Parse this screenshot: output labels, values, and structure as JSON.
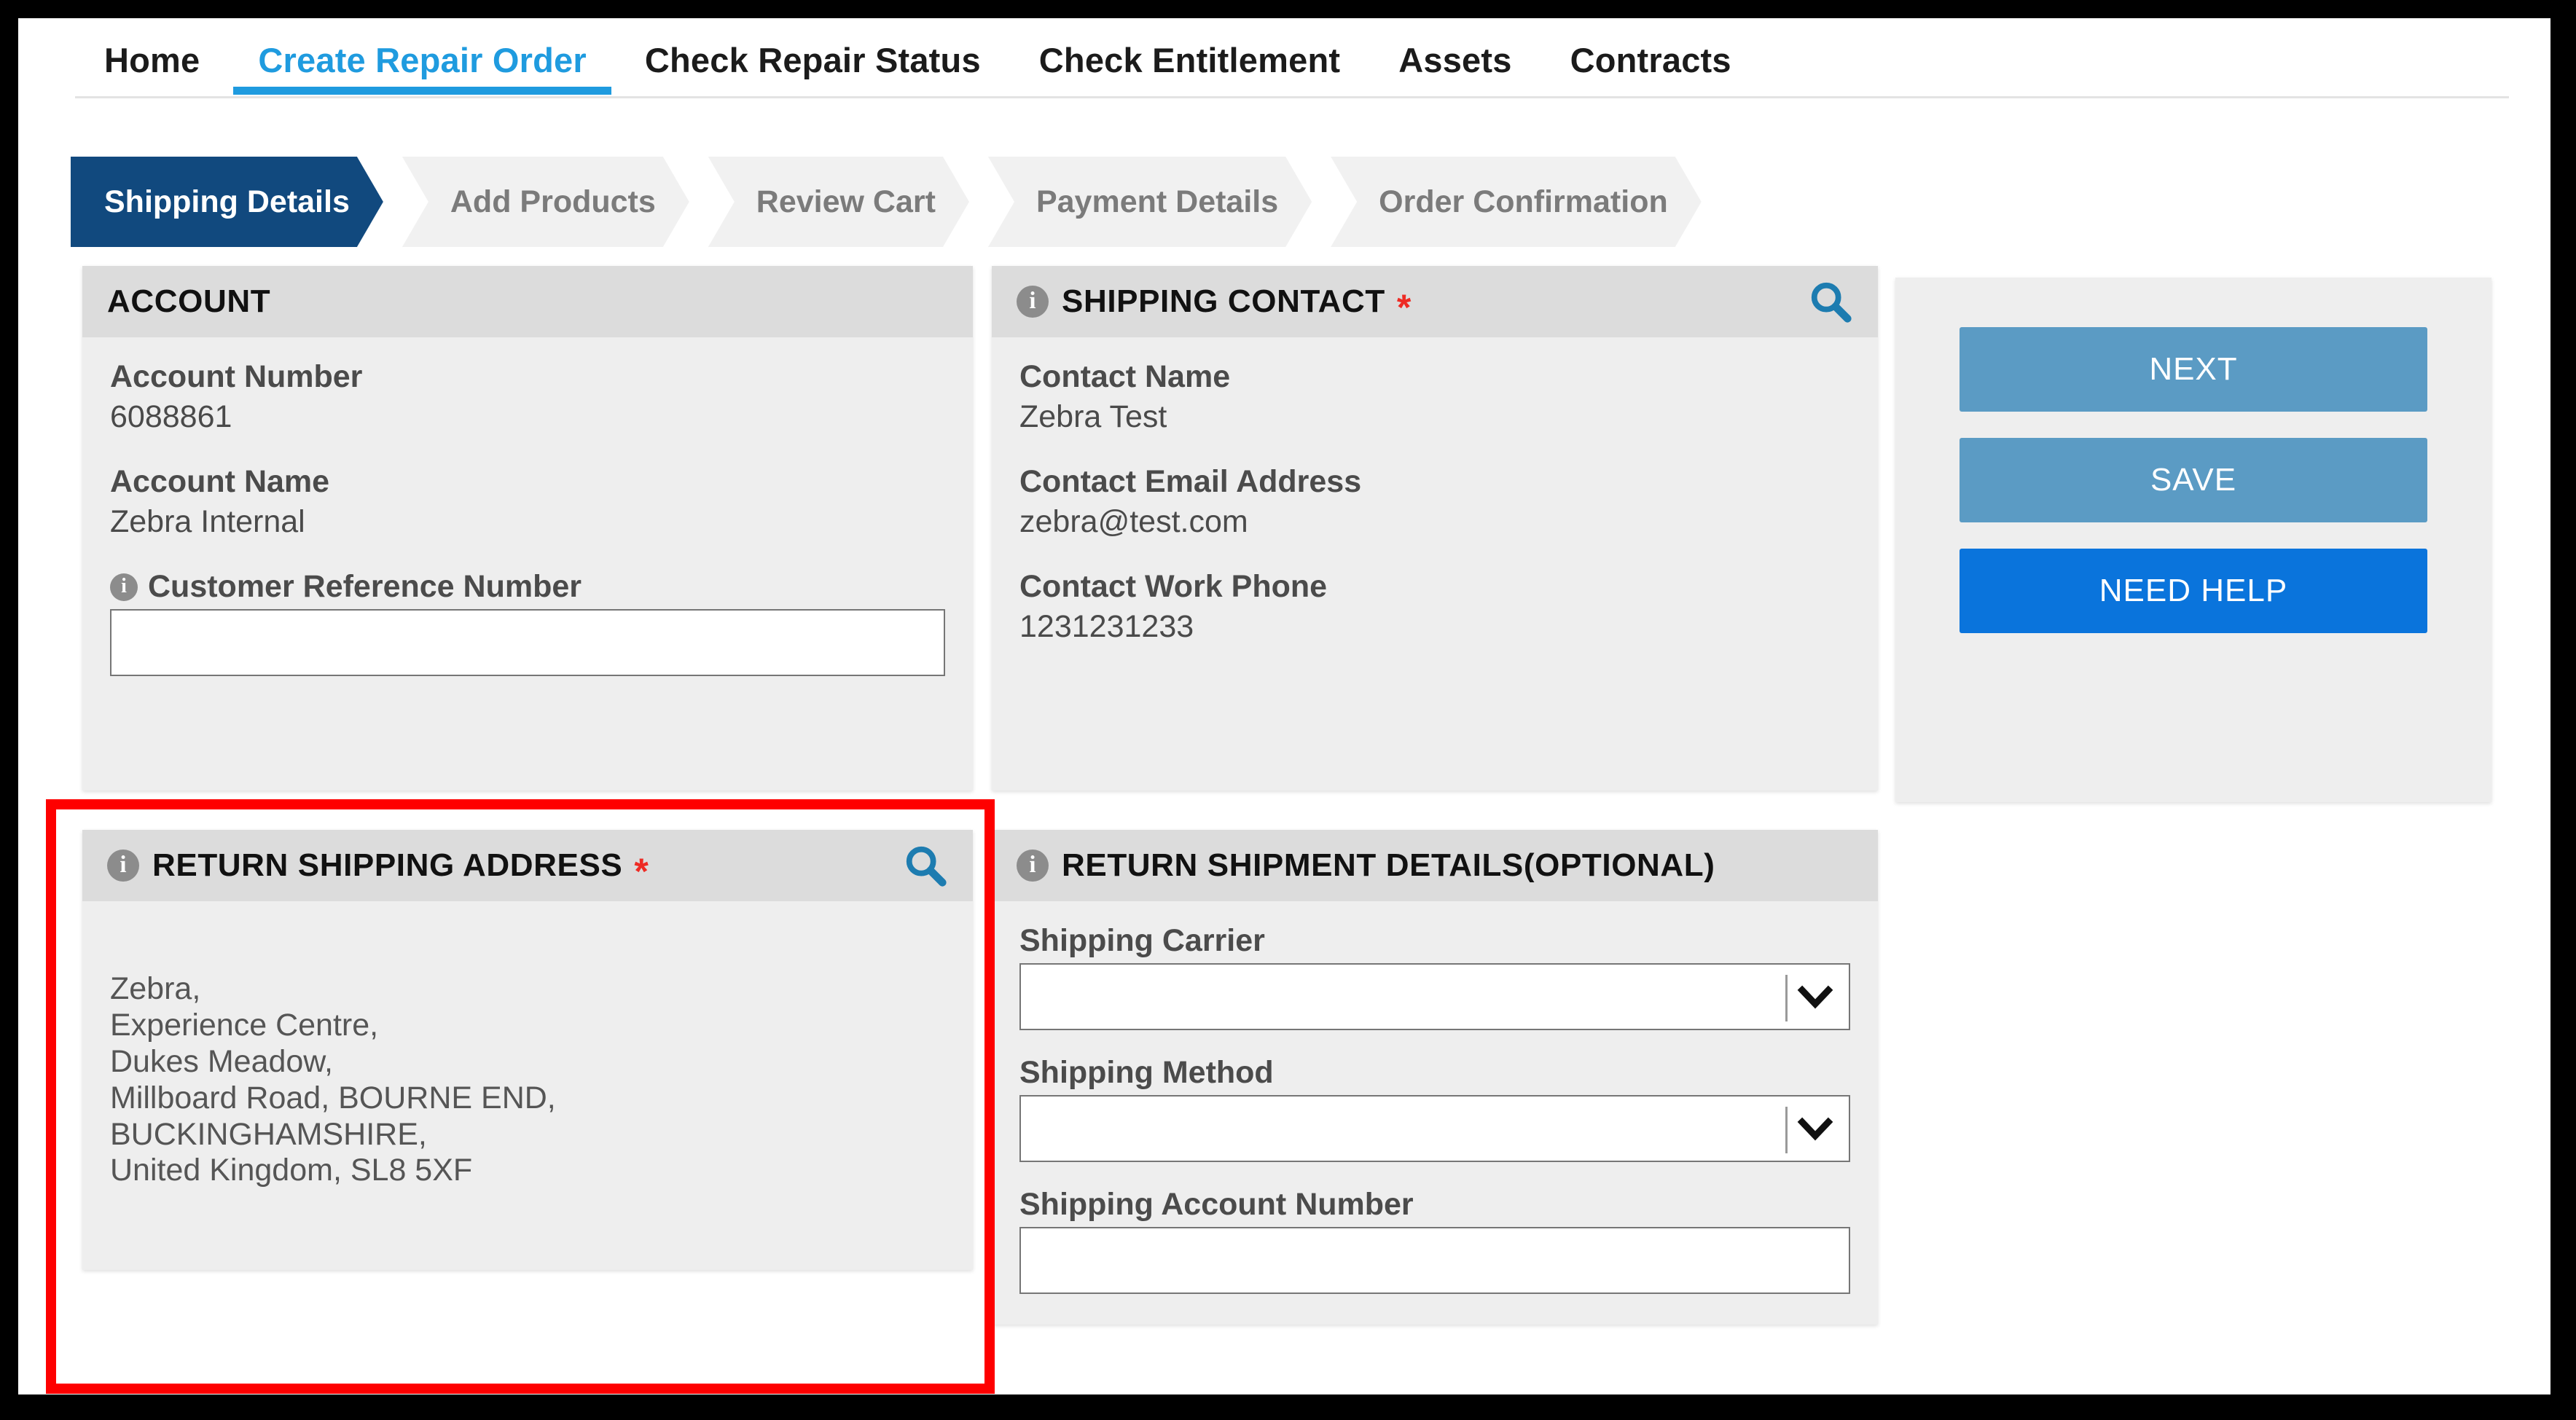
{
  "nav": {
    "tabs": [
      {
        "label": "Home",
        "active": false
      },
      {
        "label": "Create Repair Order",
        "active": true
      },
      {
        "label": "Check Repair Status",
        "active": false
      },
      {
        "label": "Check Entitlement",
        "active": false
      },
      {
        "label": "Assets",
        "active": false
      },
      {
        "label": "Contracts",
        "active": false
      }
    ]
  },
  "wizard": {
    "steps": [
      {
        "label": "Shipping Details",
        "active": true
      },
      {
        "label": "Add Products",
        "active": false
      },
      {
        "label": "Review Cart",
        "active": false
      },
      {
        "label": "Payment Details",
        "active": false
      },
      {
        "label": "Order Confirmation",
        "active": false
      }
    ]
  },
  "account_panel": {
    "title": "ACCOUNT",
    "account_number_label": "Account Number",
    "account_number_value": "6088861",
    "account_name_label": "Account Name",
    "account_name_value": "Zebra Internal",
    "customer_reference_label": "Customer Reference Number",
    "customer_reference_value": "",
    "customer_reference_placeholder": "",
    "info_icon": "info-icon"
  },
  "shipping_contact_panel": {
    "title": "SHIPPING CONTACT",
    "required_marker": "*",
    "search_icon": "search-icon",
    "info_icon": "info-icon",
    "contact_name_label": "Contact Name",
    "contact_name_value": "Zebra Test",
    "contact_email_label": "Contact Email Address",
    "contact_email_value": "zebra@test.com",
    "contact_phone_label": "Contact Work Phone",
    "contact_phone_value": "1231231233"
  },
  "return_address_panel": {
    "title": "RETURN SHIPPING ADDRESS",
    "required_marker": "*",
    "search_icon": "search-icon",
    "info_icon": "info-icon",
    "address_lines": [
      "Zebra,",
      "Experience Centre,",
      "Dukes Meadow,",
      "Millboard Road, BOURNE END,",
      "BUCKINGHAMSHIRE,",
      "United Kingdom, SL8 5XF"
    ]
  },
  "return_shipment_panel": {
    "title": "RETURN SHIPMENT DETAILS(OPTIONAL)",
    "info_icon": "info-icon",
    "shipping_carrier_label": "Shipping Carrier",
    "shipping_carrier_value": "",
    "shipping_method_label": "Shipping Method",
    "shipping_method_value": "",
    "shipping_account_label": "Shipping Account Number",
    "shipping_account_value": "",
    "chevron_icon": "chevron-down-icon"
  },
  "actions": {
    "next_label": "NEXT",
    "save_label": "SAVE",
    "help_label": "NEED HELP"
  },
  "annotation": {
    "highlight_color": "#fe0000"
  },
  "colors": {
    "active_tab": "#1f9bdf",
    "active_step": "#11497e",
    "panel_header": "#dcdcdc",
    "panel_body": "#eeeeee",
    "required_star": "#ee2b24",
    "search_icon": "#1d7cb0",
    "secondary_button": "#5b9bc4",
    "primary_button": "#0a74dc"
  }
}
